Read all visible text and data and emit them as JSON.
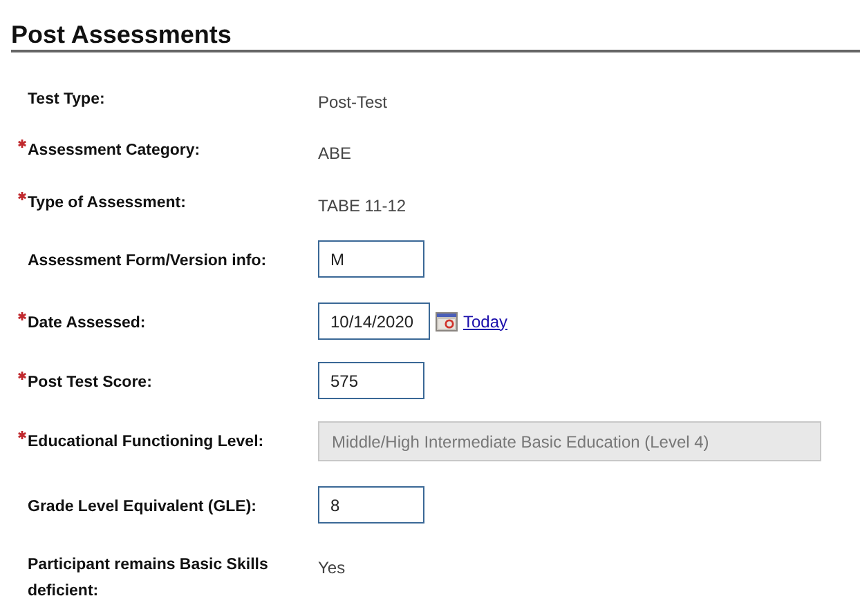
{
  "title": "Post Assessments",
  "rows": [
    {
      "label": "Test Type:",
      "required": false,
      "kind": "text",
      "value": "Post-Test"
    },
    {
      "label": "Assessment Category:",
      "required": true,
      "kind": "text",
      "value": "ABE"
    },
    {
      "label": "Type of Assessment:",
      "required": true,
      "kind": "text",
      "value": "TABE 11-12"
    },
    {
      "label": "Assessment Form/Version info:",
      "required": false,
      "kind": "input",
      "value": "M"
    },
    {
      "label": "Date Assessed:",
      "required": true,
      "kind": "date",
      "value": "10/14/2020",
      "link": "Today"
    },
    {
      "label": "Post Test Score:",
      "required": true,
      "kind": "input",
      "value": "575"
    },
    {
      "label": "Educational Functioning Level:",
      "required": true,
      "kind": "select",
      "disabled": true,
      "value": "Middle/High Intermediate Basic Education (Level 4)"
    },
    {
      "label": "Grade Level Equivalent (GLE):",
      "required": false,
      "kind": "input",
      "value": "8"
    },
    {
      "label": "Participant remains Basic Skills deficient:",
      "required": false,
      "kind": "text",
      "value": "Yes"
    }
  ]
}
